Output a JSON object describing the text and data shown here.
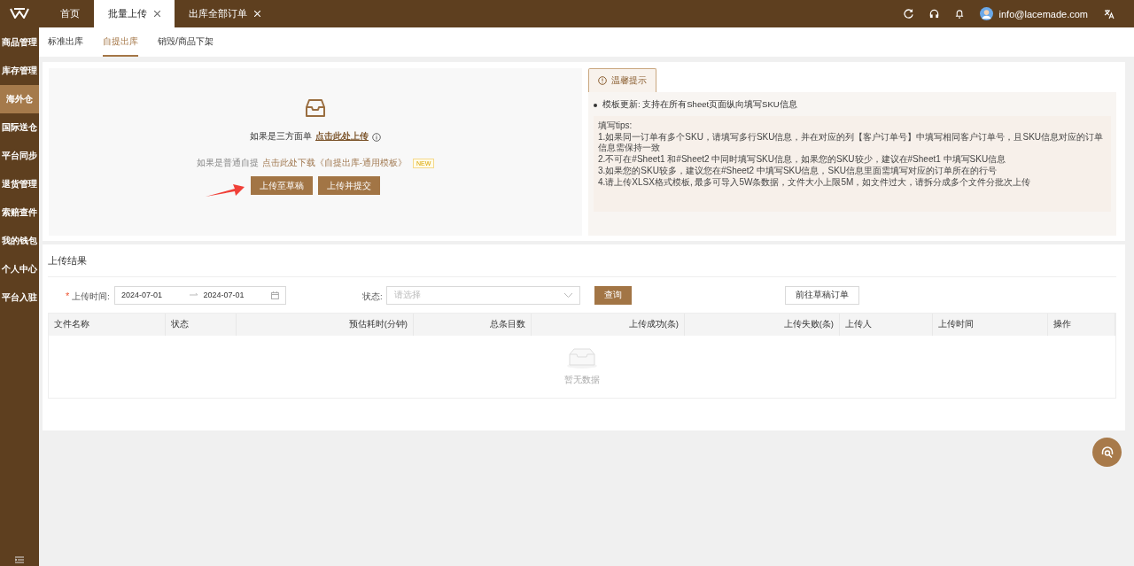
{
  "sidebar": {
    "items": [
      {
        "label": "商品管理",
        "selected": false
      },
      {
        "label": "库存管理",
        "selected": false
      },
      {
        "label": "海外仓",
        "selected": true
      },
      {
        "label": "国际送仓",
        "selected": false
      },
      {
        "label": "平台同步",
        "selected": false
      },
      {
        "label": "退货管理",
        "selected": false
      },
      {
        "label": "索赔查件",
        "selected": false
      },
      {
        "label": "我的钱包",
        "selected": false
      },
      {
        "label": "个人中心",
        "selected": false
      },
      {
        "label": "平台入驻",
        "selected": false
      }
    ]
  },
  "page_tabs": [
    {
      "label": "首页",
      "selected": false,
      "closable": false
    },
    {
      "label": "批量上传",
      "selected": true,
      "closable": true
    },
    {
      "label": "出库全部订单",
      "selected": false,
      "closable": true
    }
  ],
  "user": {
    "email": "info@lacemade.com"
  },
  "sub_tabs": [
    {
      "label": "标准出库",
      "selected": false
    },
    {
      "label": "自提出库",
      "selected": true
    },
    {
      "label": "销毁/商品下架",
      "selected": false
    }
  ],
  "upload": {
    "third_party_text": "如果是三方面单",
    "third_party_link": "点击此处上传",
    "normal_text": "如果是普通自提",
    "template_link": "点击此处下载《自提出库-通用模板》",
    "badge": "NEW",
    "buttons": [
      "上传至草稿",
      "上传并提交"
    ]
  },
  "tips": {
    "tab": "温馨提示",
    "update": "模板更新: 支持在所有Sheet页面纵向填写SKU信息",
    "lines": [
      "填写tips:",
      "1.如果同一订单有多个SKU，请填写多行SKU信息，并在对应的列【客户订单号】中填写相同客户订单号，且SKU信息对应的订单信息需保持一致",
      "2.不可在#Sheet1 和#Sheet2 中同时填写SKU信息，如果您的SKU较少，建议在#Sheet1 中填写SKU信息",
      "3.如果您的SKU较多，建议您在#Sheet2 中填写SKU信息，SKU信息里面需填写对应的订单所在的行号",
      "4.请上传XLSX格式模板, 最多可导入5W条数据，文件大小上限5M，如文件过大，请拆分成多个文件分批次上传"
    ]
  },
  "results": {
    "title": "上传结果",
    "date_label": "上传时间:",
    "date_from": "2024-07-01",
    "date_to": "2024-07-01",
    "status_label": "状态:",
    "status_placeholder": "请选择",
    "query_button": "查询",
    "drafts_button": "前往草稿订单",
    "columns": [
      {
        "label": "文件名称",
        "kind": "text"
      },
      {
        "label": "状态",
        "kind": "text"
      },
      {
        "label": "预估耗时(分钟)",
        "kind": "number"
      },
      {
        "label": "总条目数",
        "kind": "number"
      },
      {
        "label": "上传成功(条)",
        "kind": "number"
      },
      {
        "label": "上传失败(条)",
        "kind": "number"
      },
      {
        "label": "上传人",
        "kind": "text"
      },
      {
        "label": "上传时间",
        "kind": "text"
      },
      {
        "label": "操作",
        "kind": "text"
      }
    ],
    "required_mark": "*",
    "empty_text": "暂无数据"
  }
}
